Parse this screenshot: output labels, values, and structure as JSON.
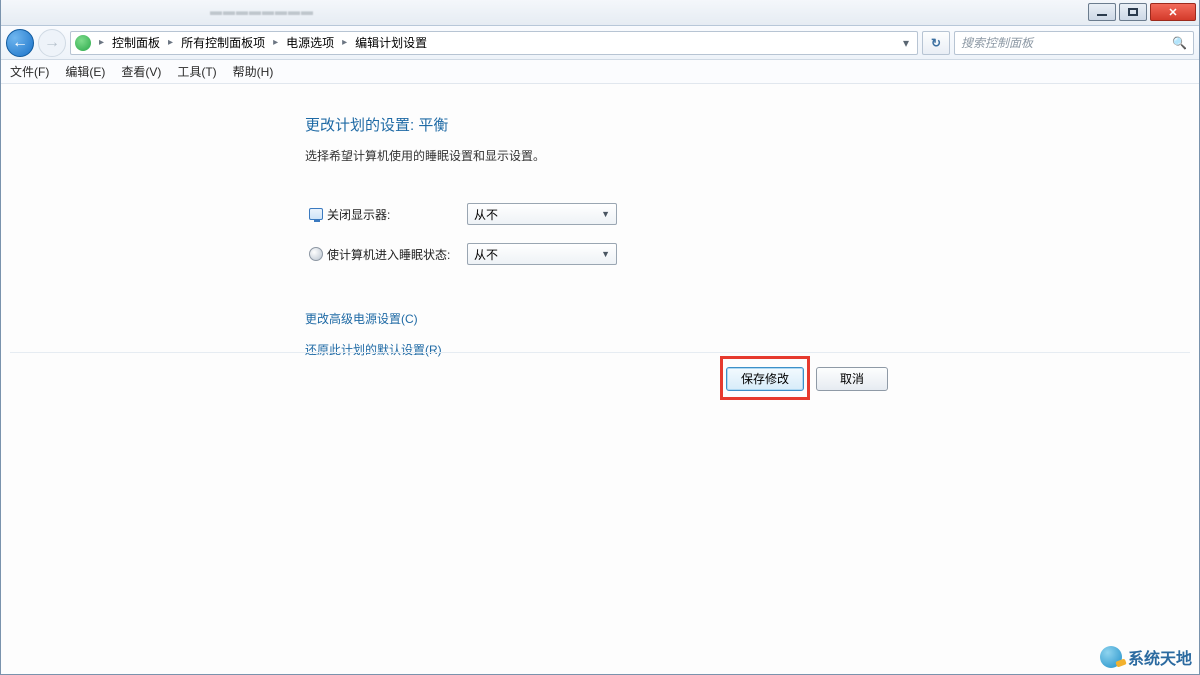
{
  "window": {
    "minimize_tip": "Minimize",
    "maximize_tip": "Maximize",
    "close_tip": "Close"
  },
  "breadcrumb": {
    "items": [
      "控制面板",
      "所有控制面板项",
      "电源选项",
      "编辑计划设置"
    ]
  },
  "search": {
    "placeholder": "搜索控制面板"
  },
  "refresh_label": "↻",
  "menubar": {
    "items": [
      "文件(F)",
      "编辑(E)",
      "查看(V)",
      "工具(T)",
      "帮助(H)"
    ]
  },
  "page": {
    "title": "更改计划的设置: 平衡",
    "subtitle": "选择希望计算机使用的睡眠设置和显示设置。"
  },
  "settings": {
    "turn_off_display": {
      "label": "关闭显示器:",
      "value": "从不"
    },
    "sleep": {
      "label": "使计算机进入睡眠状态:",
      "value": "从不"
    }
  },
  "links": {
    "advanced": "更改高级电源设置(C)",
    "restore_defaults": "还原此计划的默认设置(R)"
  },
  "buttons": {
    "save": "保存修改",
    "cancel": "取消"
  },
  "watermark": {
    "text": "系统天地"
  }
}
